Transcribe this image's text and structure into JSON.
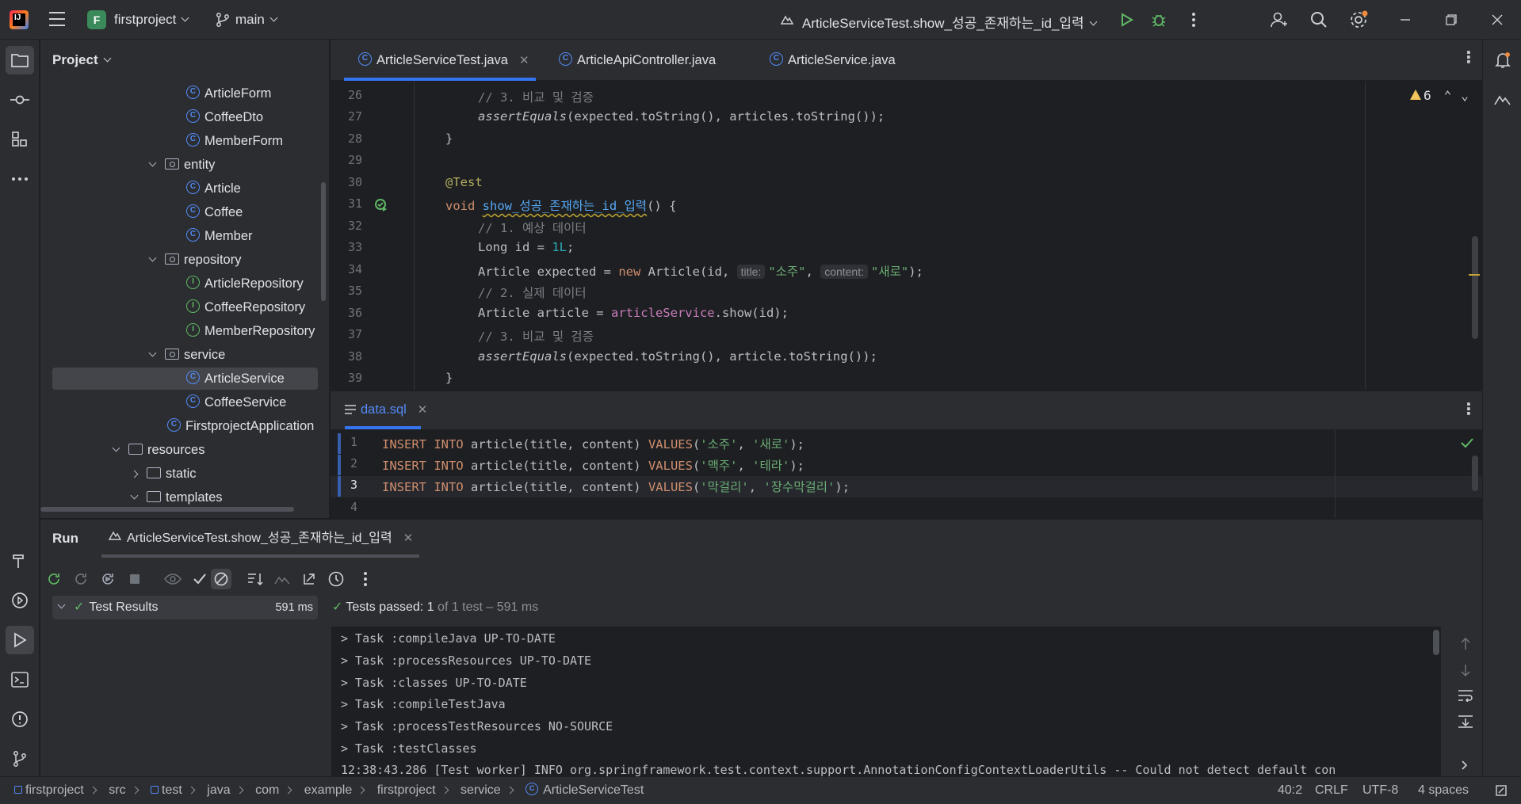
{
  "titlebar": {
    "logo_label": "IJ",
    "project_initial": "F",
    "project_name": "firstproject",
    "branch": "main",
    "run_config": "ArticleServiceTest.show_성공_존재하는_id_입력"
  },
  "project_panel": {
    "title": "Project",
    "items": [
      {
        "label": "ArticleForm",
        "kind": "class"
      },
      {
        "label": "CoffeeDto",
        "kind": "class"
      },
      {
        "label": "MemberForm",
        "kind": "class"
      },
      {
        "label": "entity",
        "kind": "package"
      },
      {
        "label": "Article",
        "kind": "class"
      },
      {
        "label": "Coffee",
        "kind": "class"
      },
      {
        "label": "Member",
        "kind": "class"
      },
      {
        "label": "repository",
        "kind": "package"
      },
      {
        "label": "ArticleRepository",
        "kind": "interface"
      },
      {
        "label": "CoffeeRepository",
        "kind": "interface"
      },
      {
        "label": "MemberRepository",
        "kind": "interface"
      },
      {
        "label": "service",
        "kind": "package"
      },
      {
        "label": "ArticleService",
        "kind": "class",
        "selected": true
      },
      {
        "label": "CoffeeService",
        "kind": "class"
      },
      {
        "label": "FirstprojectApplication",
        "kind": "class"
      },
      {
        "label": "resources",
        "kind": "folder"
      },
      {
        "label": "static",
        "kind": "folder"
      },
      {
        "label": "templates",
        "kind": "folder"
      }
    ]
  },
  "editor_tabs": [
    {
      "label": "ArticleServiceTest.java",
      "active": true
    },
    {
      "label": "ArticleApiController.java"
    },
    {
      "label": "ArticleService.java"
    }
  ],
  "editor": {
    "warnings": "6",
    "lines": [
      {
        "n": "26",
        "text": "// 3. 비교 및 검증"
      },
      {
        "n": "27",
        "text": "assertEquals(expected.toString(), articles.toString());"
      },
      {
        "n": "28",
        "text": "}"
      },
      {
        "n": "29",
        "text": ""
      },
      {
        "n": "30",
        "text": "@Test"
      },
      {
        "n": "31",
        "text": "void show_성공_존재하는_id_입력() {"
      },
      {
        "n": "32",
        "text": "// 1. 예상 데이터"
      },
      {
        "n": "33",
        "text": "Long id = 1L;"
      },
      {
        "n": "34",
        "text": "Article expected = new Article(id, title: \"소주\", content: \"새로\");"
      },
      {
        "n": "35",
        "text": "// 2. 실제 데이터"
      },
      {
        "n": "36",
        "text": "Article article = articleService.show(id);"
      },
      {
        "n": "37",
        "text": "// 3. 비교 및 검증"
      },
      {
        "n": "38",
        "text": "assertEquals(expected.toString(), article.toString());"
      },
      {
        "n": "39",
        "text": "}"
      }
    ],
    "tok": {
      "c26": "// 3. 비교 및 검증",
      "assertEquals": "assertEquals",
      "l27_rest": "(expected.toString(), articles.toString());",
      "brace_close": "}",
      "annot": "@Test",
      "void": "void",
      "method": "show_성공_존재하는_id_입력",
      "l31_rest": "() {",
      "c32": "// 1. 예상 데이터",
      "l33_a": "Long id = ",
      "l33_num": "1L",
      "l33_b": ";",
      "l34_a": "Article expected = ",
      "new": "new",
      "l34_b": " Article(id, ",
      "hint_title": "title:",
      "str_soju": "\"소주\"",
      "comma": ", ",
      "hint_content": "content:",
      "str_saero": "\"새로\"",
      "l34_end": ");",
      "c35": "// 2. 실제 데이터",
      "l36_a": "Article article = ",
      "field": "articleService",
      "l36_b": ".show(id);",
      "c37": "// 3. 비교 및 검증",
      "l38_rest": "(expected.toString(), article.toString());"
    }
  },
  "sql_tab": {
    "label": "data.sql"
  },
  "sql_editor": {
    "lines": [
      {
        "n": "1",
        "text": "INSERT INTO article(title, content) VALUES('소주', '새로');"
      },
      {
        "n": "2",
        "text": "INSERT INTO article(title, content) VALUES('맥주', '테라');"
      },
      {
        "n": "3",
        "text": "INSERT INTO article(title, content) VALUES('막걸리', '장수막걸리');"
      },
      {
        "n": "4",
        "text": ""
      }
    ],
    "tok": {
      "insert": "INSERT INTO",
      "mid": " article(title, content) ",
      "values": "VALUES",
      "open": "(",
      "sep": ", ",
      "close": ");",
      "s1a": "'소주'",
      "s1b": "'새로'",
      "s2a": "'맥주'",
      "s2b": "'테라'",
      "s3a": "'막걸리'",
      "s3b": "'장수막걸리'"
    }
  },
  "run_panel": {
    "title": "Run",
    "tab_label": "ArticleServiceTest.show_성공_존재하는_id_입력",
    "results_label": "Test Results",
    "results_time": "591 ms",
    "passed_label": "Tests passed:",
    "passed_count": "1",
    "passed_detail": "of 1 test – 591 ms",
    "console": [
      "> Task :compileJava UP-TO-DATE",
      "> Task :processResources UP-TO-DATE",
      "> Task :classes UP-TO-DATE",
      "> Task :compileTestJava",
      "> Task :processTestResources NO-SOURCE",
      "> Task :testClasses",
      "12:38:43.286 [Test worker] INFO org.springframework.test.context.support.AnnotationConfigContextLoaderUtils -- Could not detect default con"
    ]
  },
  "statusbar": {
    "crumbs": [
      "firstproject",
      "src",
      "test",
      "java",
      "com",
      "example",
      "firstproject",
      "service",
      "ArticleServiceTest"
    ],
    "position": "40:2",
    "line_sep": "CRLF",
    "encoding": "UTF-8",
    "indent": "4 spaces"
  },
  "colors": {
    "accent": "#3574f0",
    "background": "#1e1f22",
    "panel": "#2b2d30",
    "success": "#5fb865",
    "warning": "#f2c55c"
  }
}
